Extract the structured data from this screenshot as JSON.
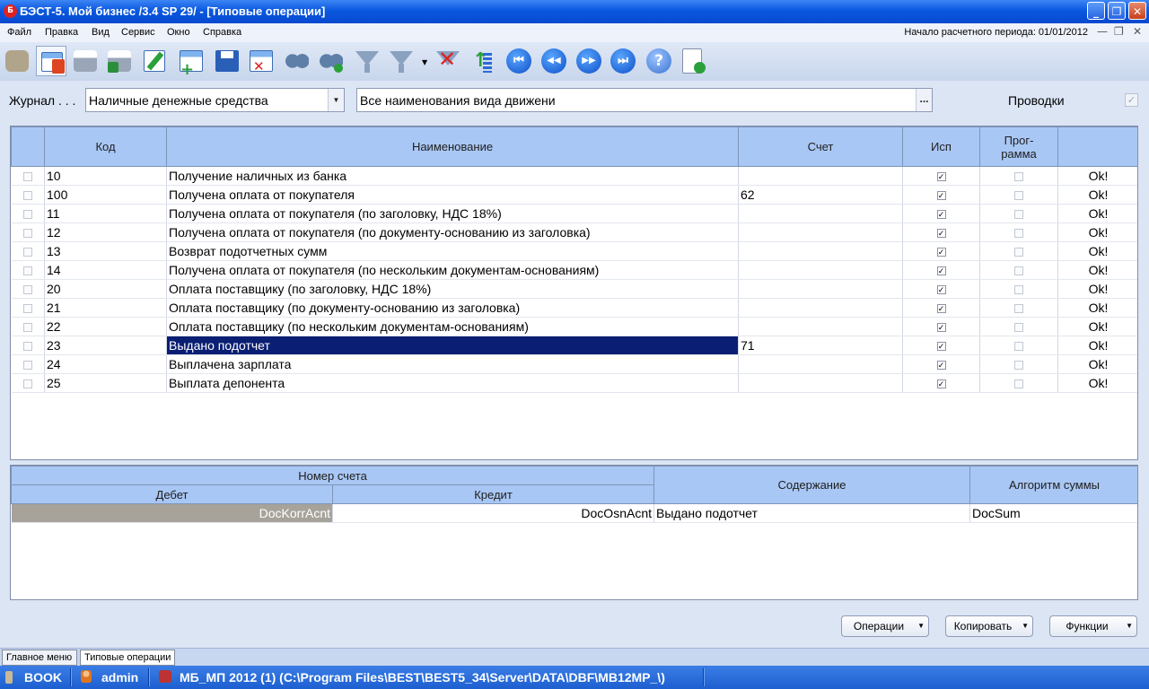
{
  "window": {
    "title": "БЭСТ-5. Мой бизнес /3.4 SP 29/ - [Типовые операции]",
    "app_icon": "Б",
    "controls": {
      "minimize": "_",
      "maximize": "❐",
      "close": "✕"
    }
  },
  "menu": {
    "items": [
      "Файл",
      "Правка",
      "Вид",
      "Сервис",
      "Окно",
      "Справка"
    ],
    "period_text": "Начало расчетного периода: 01/01/2012",
    "mdi_controls": {
      "minimize": "—",
      "restore": "❐",
      "close": "✕"
    }
  },
  "toolbar": {
    "buttons": [
      "reports-book-icon",
      "journal-grid-icon",
      "print-icon",
      "print-preview-icon",
      "edit-icon",
      "add-row-icon",
      "save-icon",
      "delete-row-icon",
      "find-icon",
      "find-next-icon",
      "filter-icon",
      "filter-dropdown-icon",
      "clear-filter-icon",
      "sort-icon",
      "first-record-icon",
      "previous-record-icon",
      "next-record-icon",
      "last-record-icon",
      "help-icon",
      "document-check-icon"
    ],
    "glyphs": {
      "first": "⏮",
      "prev": "◀◀",
      "next": "▶▶",
      "last": "⏭",
      "help": "?"
    }
  },
  "filter": {
    "journal_label": "Журнал . . .",
    "journal_value": "Наличные денежные средства",
    "movement_value": "Все наименования вида движени",
    "movement_button": "...",
    "postings_label": "Проводки",
    "postings_checked": true
  },
  "operations_table": {
    "headers": {
      "code": "Код",
      "name": "Наименование",
      "account": "Счет",
      "used": "Исп",
      "program_line1": "Прог-",
      "program_line2": "рамма"
    },
    "rows": [
      {
        "code": "10",
        "name": "Получение наличных из банка",
        "account": "",
        "used": true,
        "program": false,
        "status": "Ok!"
      },
      {
        "code": "100",
        "name": "Получена оплата от покупателя",
        "account": "62",
        "used": true,
        "program": false,
        "status": "Ok!"
      },
      {
        "code": "11",
        "name": "Получена оплата от покупателя (по заголовку, НДС 18%)",
        "account": "",
        "used": true,
        "program": false,
        "status": "Ok!"
      },
      {
        "code": "12",
        "name": "Получена оплата от покупателя (по документу-основанию из заголовка)",
        "account": "",
        "used": true,
        "program": false,
        "status": "Ok!"
      },
      {
        "code": "13",
        "name": "Возврат подотчетных сумм",
        "account": "",
        "used": true,
        "program": false,
        "status": "Ok!"
      },
      {
        "code": "14",
        "name": "Получена оплата от покупателя (по нескольким документам-основаниям)",
        "account": "",
        "used": true,
        "program": false,
        "status": "Ok!"
      },
      {
        "code": "20",
        "name": "Оплата поставщику (по заголовку, НДС 18%)",
        "account": "",
        "used": true,
        "program": false,
        "status": "Ok!"
      },
      {
        "code": "21",
        "name": "Оплата поставщику (по документу-основанию из заголовка)",
        "account": "",
        "used": true,
        "program": false,
        "status": "Ok!"
      },
      {
        "code": "22",
        "name": "Оплата поставщику (по нескольким документам-основаниям)",
        "account": "",
        "used": true,
        "program": false,
        "status": "Ok!"
      },
      {
        "code": "23",
        "name": "Выдано подотчет",
        "account": "71",
        "used": true,
        "program": false,
        "status": "Ok!",
        "selected": true
      },
      {
        "code": "24",
        "name": "Выплачена зарплата",
        "account": "",
        "used": true,
        "program": false,
        "status": "Ok!"
      },
      {
        "code": "25",
        "name": "Выплата депонента",
        "account": "",
        "used": true,
        "program": false,
        "status": "Ok!"
      }
    ]
  },
  "entries_table": {
    "headers": {
      "account_number": "Номер счета",
      "debit": "Дебет",
      "credit": "Кредит",
      "content": "Содержание",
      "sum_algorithm": "Алгоритм суммы"
    },
    "rows": [
      {
        "debit": "DocKorrAcnt",
        "credit": "DocOsnAcnt",
        "content": "Выдано подотчет",
        "sum_algorithm": "DocSum"
      }
    ]
  },
  "buttons": {
    "operations": "Операции",
    "copy": "Копировать",
    "functions": "Функции"
  },
  "tabs": [
    "Главное меню",
    "Типовые операции"
  ],
  "status": {
    "book": "BOOK",
    "user": "admin",
    "path": "МБ_МП 2012 (1) (C:\\Program Files\\BEST\\BEST5_34\\Server\\DATA\\DBF\\MB12MP_\\)"
  },
  "colors": {
    "header_bg": "#a9c7f4",
    "selection_bg": "#0a1f73",
    "title_bar": "#0a58e0",
    "status_bar": "#1d5fd0"
  }
}
